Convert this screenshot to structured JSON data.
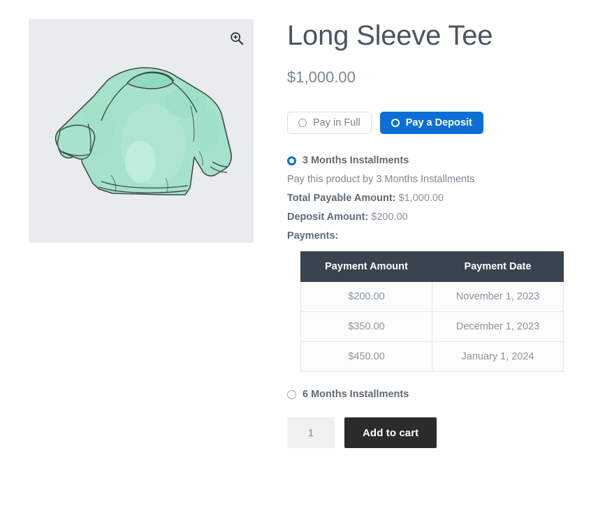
{
  "product": {
    "title": "Long Sleeve Tee",
    "price": "$1,000.00",
    "image_alt": "mint-green-long-sleeve-tee",
    "gallery_bg": "#e8ecef",
    "shirt_color": "#a6e2cb",
    "zoom_icon": "zoom-in-magnifier-icon"
  },
  "pay_type": {
    "full_label": "Pay in Full",
    "deposit_label": "Pay a Deposit",
    "selected": "Pay a Deposit",
    "accent_color": "#0d6ed6"
  },
  "plans": [
    {
      "name": "3 Months Installments",
      "selected": true,
      "description": "Pay this product by 3 Months Installments",
      "total_label": "Total Payable Amount:",
      "total_value": "$1,000.00",
      "deposit_label": "Deposit Amount:",
      "deposit_value": "$200.00",
      "payments_label": "Payments:",
      "table": {
        "headers": [
          "Payment Amount",
          "Payment Date"
        ],
        "header_bg": "#3a4450",
        "rows": [
          [
            "$200.00",
            "November 1, 2023"
          ],
          [
            "$350.00",
            "December 1, 2023"
          ],
          [
            "$450.00",
            "January 1, 2024"
          ]
        ]
      }
    },
    {
      "name": "6 Months Installments",
      "selected": false
    }
  ],
  "cart": {
    "quantity": "1",
    "quantity_placeholder": "1",
    "add_to_cart_label": "Add to cart",
    "button_color": "#2b2b2b"
  }
}
